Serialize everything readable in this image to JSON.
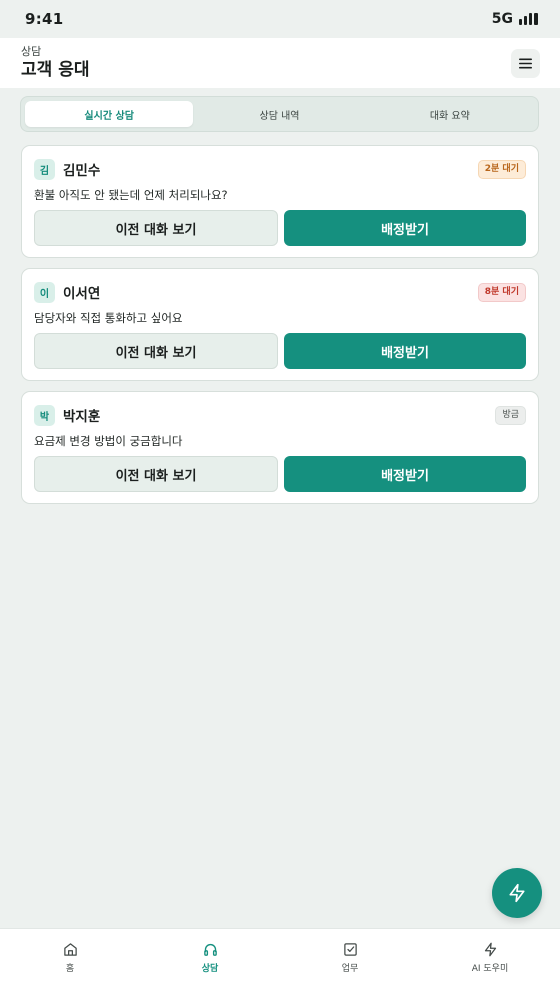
{
  "status_bar": {
    "time": "9:41",
    "network": "5G"
  },
  "header": {
    "subtitle": "상담",
    "title": "고객 응대"
  },
  "tabs": [
    {
      "label": "실시간 상담",
      "active": true
    },
    {
      "label": "상담 내역",
      "active": false
    },
    {
      "label": "대화 요약",
      "active": false
    }
  ],
  "cards": [
    {
      "initial": "김",
      "name": "김민수",
      "badge": "2분 대기",
      "badge_color": "#b8651a",
      "message": "환불 아직도 안 됐는데 언제 처리되나요?",
      "history_label": "이전 대화 보기",
      "assign_label": "배정받기"
    },
    {
      "initial": "이",
      "name": "이서연",
      "badge": "8분 대기",
      "badge_color": "#c0392b",
      "message": "담당자와 직접 통화하고 싶어요",
      "history_label": "이전 대화 보기",
      "assign_label": "배정받기"
    },
    {
      "initial": "박",
      "name": "박지훈",
      "badge": "방금",
      "badge_color": "#4a514f",
      "message": "요금제 변경 방법이 궁금합니다",
      "history_label": "이전 대화 보기",
      "assign_label": "배정받기"
    }
  ],
  "fab": {
    "icon": "lightning-icon"
  },
  "bottom_nav": [
    {
      "label": "홈",
      "icon": "home-icon",
      "active": false
    },
    {
      "label": "상담",
      "icon": "headphones-icon",
      "active": true
    },
    {
      "label": "업무",
      "icon": "checkbox-icon",
      "active": false
    },
    {
      "label": "AI 도우미",
      "icon": "lightning-icon",
      "active": false
    }
  ],
  "colors": {
    "accent": "#15907f",
    "background": "#edf1ef"
  }
}
